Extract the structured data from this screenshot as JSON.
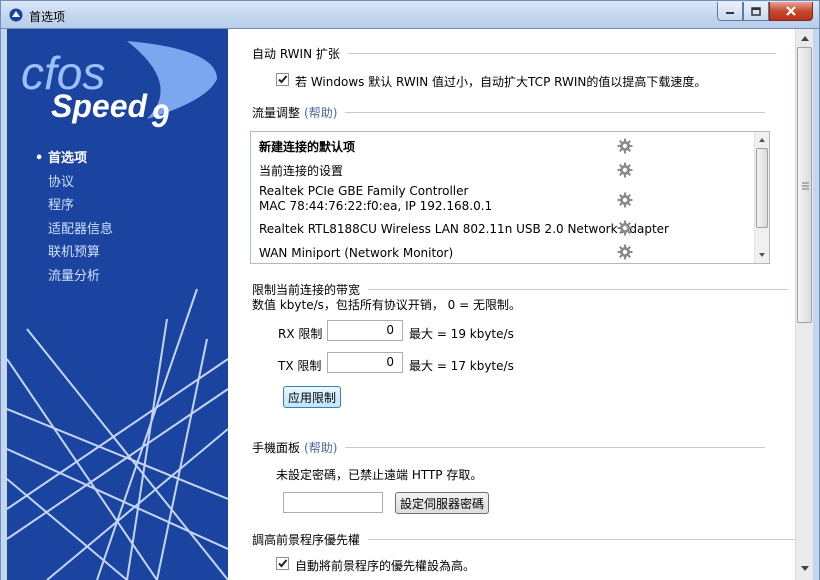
{
  "window": {
    "title": "首选项"
  },
  "sidebar": {
    "logo": {
      "word1": "cfos",
      "word2": "Speed",
      "version": "9"
    },
    "items": [
      {
        "label": "首选项",
        "active": true
      },
      {
        "label": "协议"
      },
      {
        "label": "程序"
      },
      {
        "label": "适配器信息"
      },
      {
        "label": "联机预算"
      },
      {
        "label": "流量分析"
      }
    ]
  },
  "sections": {
    "rwin": {
      "title": "自动 RWIN 扩张",
      "checkbox_label": "若 Windows 默认 RWIN 值过小，自动扩大TCP RWIN的值以提高下载速度。",
      "checked": true
    },
    "traffic": {
      "title": "流量调整",
      "help_open": "(",
      "help": "帮助",
      "help_close": ")",
      "items": [
        {
          "line1": "新建连接的默认项",
          "bold": true
        },
        {
          "line1": "当前连接的设置"
        },
        {
          "line1": "Realtek PCIe GBE Family Controller",
          "line2": "MAC 78:44:76:22:f0:ea, IP 192.168.0.1"
        },
        {
          "line1": "Realtek RTL8188CU Wireless LAN 802.11n USB 2.0 Network Adapter"
        },
        {
          "line1": "WAN Miniport (Network Monitor)"
        }
      ],
      "gear_icon": "gear-icon"
    },
    "bandwidth": {
      "title": "限制当前连接的带宽",
      "desc": "数值 kbyte/s，包括所有协议开销， 0 = 无限制。",
      "rx_label": "RX 限制",
      "rx_value": "0",
      "rx_max": "最大 = 19 kbyte/s",
      "tx_label": "TX 限制",
      "tx_value": "0",
      "tx_max": "最大 = 17 kbyte/s",
      "apply_label": "应用限制"
    },
    "mobile": {
      "title": "手機面板",
      "help_open": "(",
      "help": "帮助",
      "help_close": ")",
      "desc": "未設定密碼，已禁止遠端 HTTP 存取。",
      "password_value": "",
      "set_password_label": "設定伺服器密碼"
    },
    "priority": {
      "title": "調高前景程序優先權",
      "checkbox_label": "自動將前景程序的優先權設為高。",
      "checked": true
    }
  },
  "colors": {
    "sidebar": "#1a44a0",
    "accent": "#3c7fb1"
  }
}
